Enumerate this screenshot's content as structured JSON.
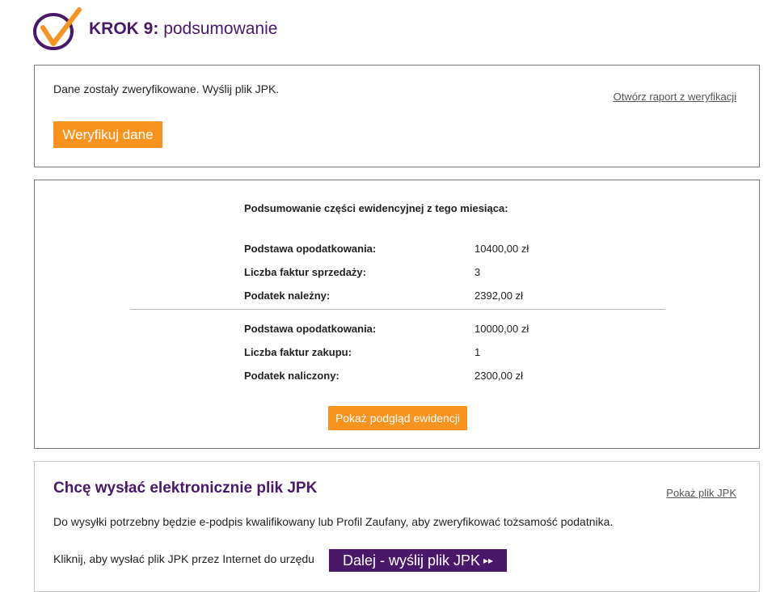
{
  "header": {
    "step": "KROK 9:",
    "subtitle": "podsumowanie"
  },
  "verify_panel": {
    "message": "Dane zostały zweryfikowane. Wyślij plik JPK.",
    "report_link": "Otwórz raport z weryfikacji",
    "verify_button": "Weryfikuj dane"
  },
  "summary": {
    "title": "Podsumowanie części ewidencyjnej z tego miesiąca:",
    "sales": [
      {
        "label": "Podstawa opodatkowania:",
        "value": "10400,00 zł"
      },
      {
        "label": "Liczba faktur sprzedaży:",
        "value": "3"
      },
      {
        "label": "Podatek należny:",
        "value": "2392,00 zł"
      }
    ],
    "purchases": [
      {
        "label": "Podstawa opodatkowania:",
        "value": "10000,00 zł"
      },
      {
        "label": "Liczba faktur zakupu:",
        "value": "1"
      },
      {
        "label": "Podatek naliczony:",
        "value": "2300,00 zł"
      }
    ],
    "preview_button": "Pokaż podgląd ewidencji"
  },
  "send_panel": {
    "title": "Chcę wysłać elektronicznie plik JPK",
    "show_link": "Pokaż plik JPK",
    "info": "Do wysyłki potrzebny będzie e-podpis kwalifikowany lub Profil Zaufany, aby zweryfikować tożsamość podatnika.",
    "click_text": "Kliknij, aby wysłać plik JPK przez Internet do urzędu",
    "send_button": "Dalej - wyślij plik JPK",
    "send_button_icon": "▸▸"
  },
  "colors": {
    "accent_orange": "#f7931e",
    "brand_purple": "#4a1868"
  }
}
